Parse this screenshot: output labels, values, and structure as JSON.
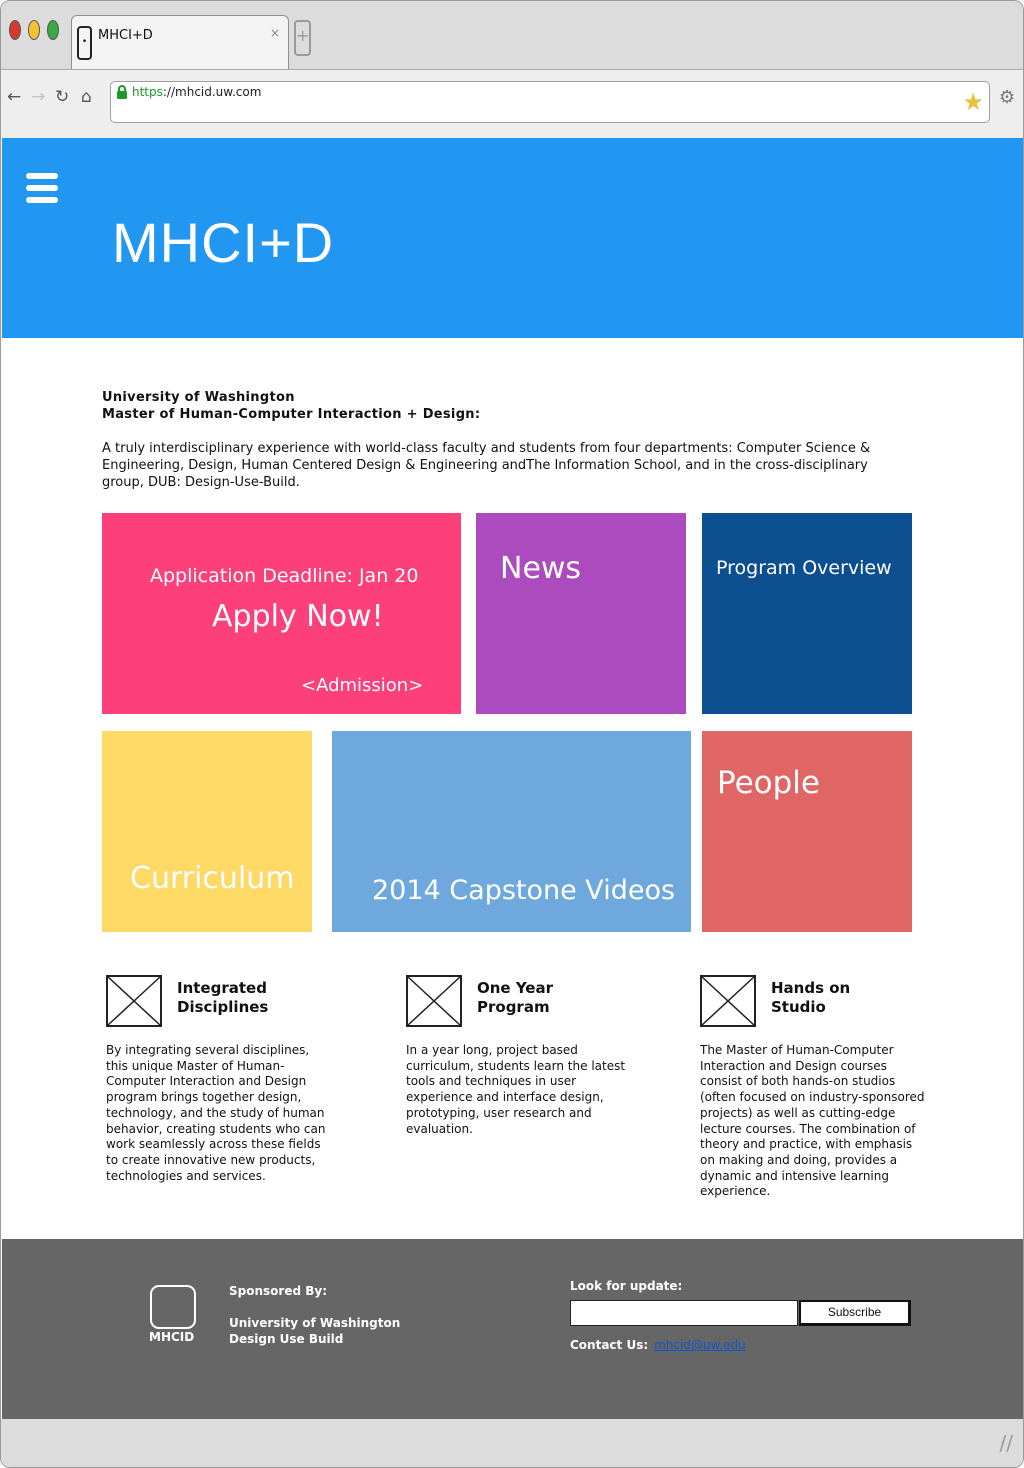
{
  "browser": {
    "tab_title": "MHCI+D",
    "tab_close": "×",
    "new_tab": "+",
    "url_protocol": "https",
    "url_rest": "://mhcid.uw.com",
    "icons": [
      "back-arrow-icon",
      "forward-arrow-icon",
      "reload-icon",
      "home-icon",
      "lock-icon",
      "bookmark-star-icon",
      "settings-gear-icon"
    ]
  },
  "header": {
    "title": "MHCI+D",
    "bg_color": "#2297f1"
  },
  "intro": {
    "line1": "University of Washington",
    "line2": "Master of Human-Computer Interaction + Design:",
    "description": "A truly interdisciplinary experience with world-class faculty and students from four departments: Computer Science & Engineering, Design, Human Centered Design & Engineering andThe Information School, and in the cross-disciplinary group, DUB: Design-Use-Build."
  },
  "tiles": {
    "apply": {
      "deadline": "Application Deadline: Jan 20",
      "cta": "Apply Now!",
      "link": "<Admission>",
      "color": "#fd3f7c"
    },
    "news": {
      "label": "News",
      "color": "#ab4bbd"
    },
    "overview": {
      "label": "Program Overview",
      "color": "#0c4f90"
    },
    "curriculum": {
      "label": "Curriculum",
      "color": "#fed966"
    },
    "capstone": {
      "label": "2014 Capstone Videos",
      "color": "#6fa8dc"
    },
    "people": {
      "label": "People",
      "color": "#e06666"
    }
  },
  "features": [
    {
      "title": "Integrated\nDisciplines",
      "body": "By integrating several disciplines, this unique Master of Human-Computer Interaction and Design program brings together design, technology, and the study of human behavior, creating students who can work seamlessly across these fields to create innovative new products, technologies and services."
    },
    {
      "title": "One Year\nProgram",
      "body": "In a year long, project based curriculum, students learn the latest tools and techniques in user experience and interface design, prototyping, user research and evaluation."
    },
    {
      "title": "Hands on\nStudio",
      "body": "The Master of Human-Computer Interaction and Design courses consist of both hands-on studios (often focused on industry-sponsored projects) as well as cutting-edge lecture courses. The combination of theory and practice, with emphasis on making and doing, provides a dynamic and intensive learning experience."
    }
  ],
  "footer": {
    "logo_text": "MHCID",
    "sponsored_label": "Sponsored By:",
    "sponsor1": "University of Washington",
    "sponsor2": "Design Use Build",
    "update_label": "Look for update:",
    "email_value": "",
    "subscribe_label": "Subscribe",
    "contact_label": "Contact Us:",
    "contact_email": "mhcid@uw.edu",
    "bg_color": "#666666"
  }
}
